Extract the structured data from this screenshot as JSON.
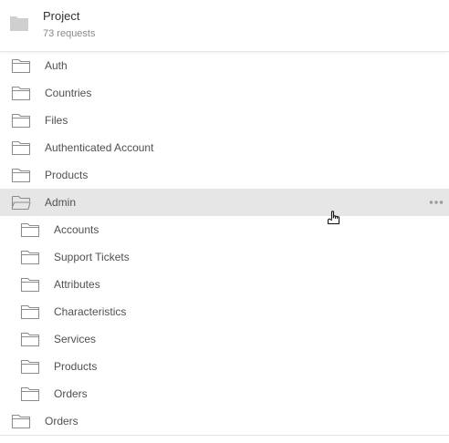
{
  "header": {
    "title": "Project",
    "subtitle": "73 requests",
    "icon": "folder-filled-icon"
  },
  "folders": [
    {
      "label": "Auth",
      "level": 0,
      "open": false,
      "selected": false
    },
    {
      "label": "Countries",
      "level": 0,
      "open": false,
      "selected": false
    },
    {
      "label": "Files",
      "level": 0,
      "open": false,
      "selected": false
    },
    {
      "label": "Authenticated Account",
      "level": 0,
      "open": false,
      "selected": false
    },
    {
      "label": "Products",
      "level": 0,
      "open": false,
      "selected": false
    },
    {
      "label": "Admin",
      "level": 0,
      "open": true,
      "selected": true
    },
    {
      "label": "Accounts",
      "level": 1,
      "open": false,
      "selected": false
    },
    {
      "label": "Support Tickets",
      "level": 1,
      "open": false,
      "selected": false
    },
    {
      "label": "Attributes",
      "level": 1,
      "open": false,
      "selected": false
    },
    {
      "label": "Characteristics",
      "level": 1,
      "open": false,
      "selected": false
    },
    {
      "label": "Services",
      "level": 1,
      "open": false,
      "selected": false
    },
    {
      "label": "Products",
      "level": 1,
      "open": false,
      "selected": false
    },
    {
      "label": "Orders",
      "level": 1,
      "open": false,
      "selected": false
    },
    {
      "label": "Orders",
      "level": 0,
      "open": false,
      "selected": false
    }
  ],
  "colors": {
    "selected_bg": "#e6e6e6",
    "text": "#505050",
    "icon_stroke": "#8c8c8c",
    "header_icon_fill": "#cfcfcf"
  },
  "icons": {
    "folder_closed": "folder-icon",
    "folder_open": "folder-open-icon",
    "more": "more-horizontal-icon",
    "cursor": "hand-pointer-icon"
  }
}
